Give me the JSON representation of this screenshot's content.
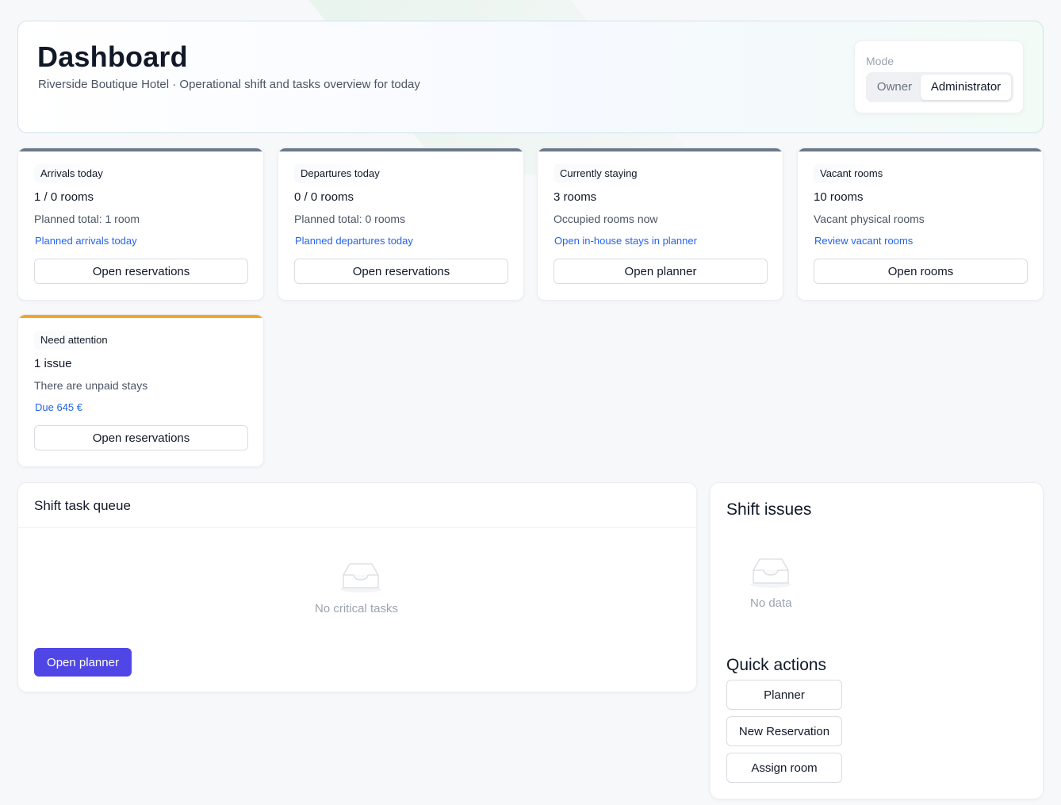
{
  "header": {
    "title": "Dashboard",
    "subtitle": "Riverside Boutique Hotel · Operational shift and tasks overview for today"
  },
  "mode": {
    "label": "Mode",
    "options": [
      "Owner",
      "Administrator"
    ],
    "selected": "Administrator"
  },
  "stats": [
    {
      "tag": "Arrivals today",
      "value": "1 / 0 rooms",
      "desc": "Planned total: 1 room",
      "link": "Planned arrivals today",
      "button": "Open reservations",
      "accent": "#6b7889"
    },
    {
      "tag": "Departures today",
      "value": "0 / 0 rooms",
      "desc": "Planned total: 0 rooms",
      "link": "Planned departures today",
      "button": "Open reservations",
      "accent": "#6b7889"
    },
    {
      "tag": "Currently staying",
      "value": "3 rooms",
      "desc": "Occupied rooms now",
      "link": "Open in-house stays in planner",
      "button": "Open planner",
      "accent": "#6b7889"
    },
    {
      "tag": "Vacant rooms",
      "value": "10 rooms",
      "desc": "Vacant physical rooms",
      "link": "Review vacant rooms",
      "button": "Open rooms",
      "accent": "#6b7889"
    },
    {
      "tag": "Need attention",
      "value": "1 issue",
      "desc": "There are unpaid stays",
      "link": "Due 645 €",
      "button": "Open reservations",
      "accent": "#f5a623"
    }
  ],
  "task_queue": {
    "title": "Shift task queue",
    "empty_text": "No critical tasks",
    "empty_icon": "inbox-icon",
    "button": "Open planner"
  },
  "shift_issues": {
    "title": "Shift issues",
    "empty_text": "No data",
    "empty_icon": "inbox-icon"
  },
  "quick_actions": {
    "title": "Quick actions",
    "buttons": [
      "Planner",
      "New Reservation",
      "Assign room"
    ]
  },
  "colors": {
    "primary": "#4f46e5",
    "link": "#2563eb",
    "neutral_accent": "#6b7889",
    "warning_accent": "#f5a623"
  }
}
